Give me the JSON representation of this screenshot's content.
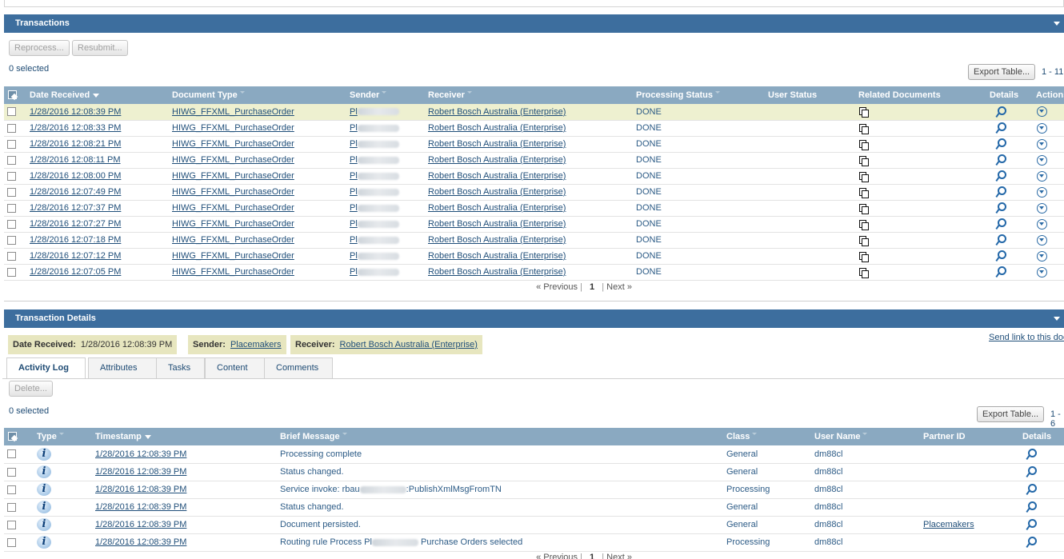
{
  "transactions": {
    "title": "Transactions",
    "buttons": {
      "reprocess": "Reprocess...",
      "resubmit": "Resubmit..."
    },
    "selected": "0 selected",
    "export": "Export Table...",
    "range": "1 - 11",
    "columns": {
      "date": "Date Received",
      "doctype": "Document Type",
      "sender": "Sender",
      "receiver": "Receiver",
      "status": "Processing Status",
      "user_status": "User Status",
      "related": "Related Documents",
      "details": "Details",
      "actions": "Actions"
    },
    "rows": [
      {
        "date": "1/28/2016 12:08:39 PM",
        "doctype": "HIWG_FFXML_PurchaseOrder",
        "sender": "Pl",
        "receiver": "Robert Bosch Australia (Enterprise)",
        "status": "DONE"
      },
      {
        "date": "1/28/2016 12:08:33 PM",
        "doctype": "HIWG_FFXML_PurchaseOrder",
        "sender": "Pl",
        "receiver": "Robert Bosch Australia (Enterprise)",
        "status": "DONE"
      },
      {
        "date": "1/28/2016 12:08:21 PM",
        "doctype": "HIWG_FFXML_PurchaseOrder",
        "sender": "Pl",
        "receiver": "Robert Bosch Australia (Enterprise)",
        "status": "DONE"
      },
      {
        "date": "1/28/2016 12:08:11 PM",
        "doctype": "HIWG_FFXML_PurchaseOrder",
        "sender": "Pl",
        "receiver": "Robert Bosch Australia (Enterprise)",
        "status": "DONE"
      },
      {
        "date": "1/28/2016 12:08:00 PM",
        "doctype": "HIWG_FFXML_PurchaseOrder",
        "sender": "Pl",
        "receiver": "Robert Bosch Australia (Enterprise)",
        "status": "DONE"
      },
      {
        "date": "1/28/2016 12:07:49 PM",
        "doctype": "HIWG_FFXML_PurchaseOrder",
        "sender": "Pl",
        "receiver": "Robert Bosch Australia (Enterprise)",
        "status": "DONE"
      },
      {
        "date": "1/28/2016 12:07:37 PM",
        "doctype": "HIWG_FFXML_PurchaseOrder",
        "sender": "Pl",
        "receiver": "Robert Bosch Australia (Enterprise)",
        "status": "DONE"
      },
      {
        "date": "1/28/2016 12:07:27 PM",
        "doctype": "HIWG_FFXML_PurchaseOrder",
        "sender": "Pl",
        "receiver": "Robert Bosch Australia (Enterprise)",
        "status": "DONE"
      },
      {
        "date": "1/28/2016 12:07:18 PM",
        "doctype": "HIWG_FFXML_PurchaseOrder",
        "sender": "Pl",
        "receiver": "Robert Bosch Australia (Enterprise)",
        "status": "DONE"
      },
      {
        "date": "1/28/2016 12:07:12 PM",
        "doctype": "HIWG_FFXML_PurchaseOrder",
        "sender": "Pl",
        "receiver": "Robert Bosch Australia (Enterprise)",
        "status": "DONE"
      },
      {
        "date": "1/28/2016 12:07:05 PM",
        "doctype": "HIWG_FFXML_PurchaseOrder",
        "sender": "Pl",
        "receiver": "Robert Bosch Australia (Enterprise)",
        "status": "DONE"
      }
    ],
    "pager": {
      "previous": "« Previous",
      "current": "1",
      "next": "Next »"
    }
  },
  "details": {
    "title": "Transaction Details",
    "date_label": "Date Received:",
    "date_value": "1/28/2016 12:08:39 PM",
    "sender_label": "Sender:",
    "sender_value": "Placemakers",
    "receiver_label": "Receiver:",
    "receiver_value": "Robert Bosch Australia (Enterprise)",
    "send_link": "Send link to this document",
    "tabs": [
      "Activity Log",
      "Attributes",
      "Tasks",
      "Content",
      "Comments"
    ],
    "delete": "Delete...",
    "selected": "0 selected",
    "export": "Export Table...",
    "range": "1 - 6",
    "columns": {
      "type": "Type",
      "timestamp": "Timestamp",
      "brief": "Brief Message",
      "class": "Class",
      "user": "User Name",
      "partner": "Partner ID",
      "details": "Details"
    },
    "rows": [
      {
        "timestamp": "1/28/2016 12:08:39 PM",
        "msg_a": "Processing complete",
        "msg_b": "",
        "class": "General",
        "user": "dm88cl",
        "partner": ""
      },
      {
        "timestamp": "1/28/2016 12:08:39 PM",
        "msg_a": "Status changed.",
        "msg_b": "",
        "class": "General",
        "user": "dm88cl",
        "partner": ""
      },
      {
        "timestamp": "1/28/2016 12:08:39 PM",
        "msg_a": "Service invoke: rbau",
        "msg_b": ":PublishXmlMsgFromTN",
        "class": "Processing",
        "user": "dm88cl",
        "partner": ""
      },
      {
        "timestamp": "1/28/2016 12:08:39 PM",
        "msg_a": "Status changed.",
        "msg_b": "",
        "class": "General",
        "user": "dm88cl",
        "partner": ""
      },
      {
        "timestamp": "1/28/2016 12:08:39 PM",
        "msg_a": "Document persisted.",
        "msg_b": "",
        "class": "General",
        "user": "dm88cl",
        "partner": "Placemakers"
      },
      {
        "timestamp": "1/28/2016 12:08:39 PM",
        "msg_a": "Routing rule Process Pl",
        "msg_b": " Purchase Orders selected",
        "class": "Processing",
        "user": "dm88cl",
        "partner": ""
      }
    ],
    "pager": {
      "previous": "« Previous",
      "current": "1",
      "next": "Next »"
    }
  },
  "colors": {
    "header": "#3d6e9e",
    "column_header": "#8aa9c1",
    "highlight": "#eef0d0",
    "link": "#1f4e79"
  }
}
